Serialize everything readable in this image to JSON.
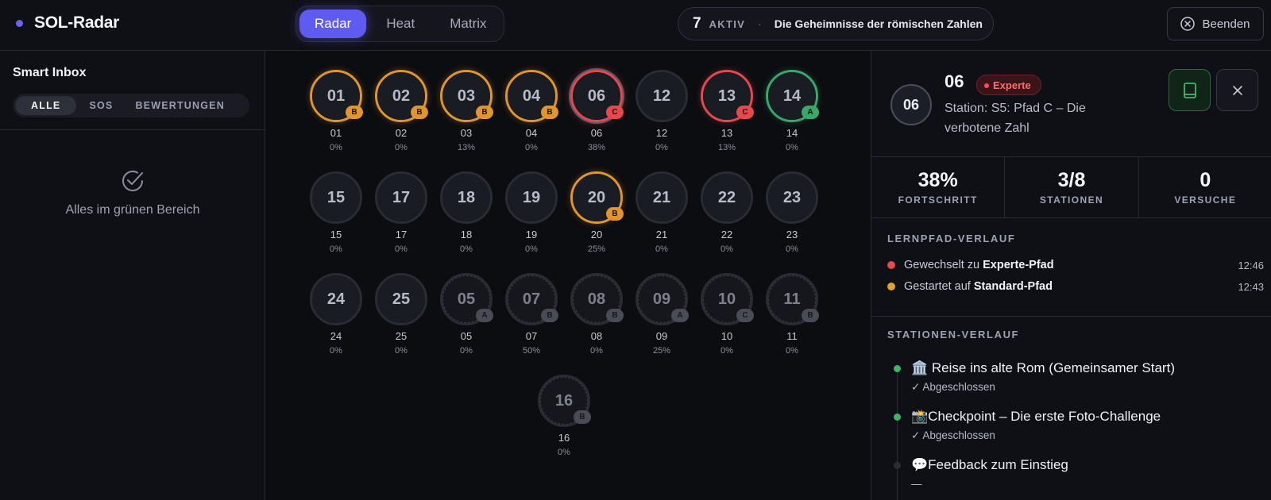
{
  "app": {
    "title": "SOL-Radar"
  },
  "tabs": [
    {
      "label": "Radar",
      "active": true
    },
    {
      "label": "Heat",
      "active": false
    },
    {
      "label": "Matrix",
      "active": false
    }
  ],
  "status": {
    "count": "7",
    "label": "AKTIV",
    "separator": "·",
    "title": "Die Geheimnisse der römischen Zahlen"
  },
  "end_button": {
    "label": "Beenden"
  },
  "inbox": {
    "title": "Smart Inbox",
    "filters": [
      {
        "label": "ALLE",
        "active": true
      },
      {
        "label": "SOS",
        "active": false
      },
      {
        "label": "BEWERTUNGEN",
        "active": false
      }
    ],
    "empty_text": "Alles im grünen Bereich"
  },
  "colors": {
    "B": "#e0952e",
    "C": "#e5484d",
    "A": "#3aa86b",
    "none": "#2c2e38"
  },
  "stations": [
    {
      "id": "01",
      "label": "01",
      "pct": "0%",
      "badge": "B",
      "ring": "B",
      "dim": false
    },
    {
      "id": "02",
      "label": "02",
      "pct": "0%",
      "badge": "B",
      "ring": "B",
      "dim": false
    },
    {
      "id": "03",
      "label": "03",
      "pct": "13%",
      "badge": "B",
      "ring": "B",
      "dim": false
    },
    {
      "id": "04",
      "label": "04",
      "pct": "0%",
      "badge": "B",
      "ring": "B",
      "dim": false
    },
    {
      "id": "06",
      "label": "06",
      "pct": "38%",
      "badge": "C",
      "ring": "C",
      "dim": false,
      "selected": true
    },
    {
      "id": "12",
      "label": "12",
      "pct": "0%",
      "badge": "",
      "ring": "none",
      "dim": false
    },
    {
      "id": "13",
      "label": "13",
      "pct": "13%",
      "badge": "C",
      "ring": "C",
      "dim": false
    },
    {
      "id": "14",
      "label": "14",
      "pct": "0%",
      "badge": "A",
      "ring": "A",
      "dim": false
    },
    {
      "id": "15",
      "label": "15",
      "pct": "0%",
      "badge": "",
      "ring": "none",
      "dim": false
    },
    {
      "id": "17",
      "label": "17",
      "pct": "0%",
      "badge": "",
      "ring": "none",
      "dim": false
    },
    {
      "id": "18",
      "label": "18",
      "pct": "0%",
      "badge": "",
      "ring": "none",
      "dim": false
    },
    {
      "id": "19",
      "label": "19",
      "pct": "0%",
      "badge": "",
      "ring": "none",
      "dim": false
    },
    {
      "id": "20",
      "label": "20",
      "pct": "25%",
      "badge": "B",
      "ring": "B",
      "dim": false
    },
    {
      "id": "21",
      "label": "21",
      "pct": "0%",
      "badge": "",
      "ring": "none",
      "dim": false
    },
    {
      "id": "22",
      "label": "22",
      "pct": "0%",
      "badge": "",
      "ring": "none",
      "dim": false
    },
    {
      "id": "23",
      "label": "23",
      "pct": "0%",
      "badge": "",
      "ring": "none",
      "dim": false
    },
    {
      "id": "24",
      "label": "24",
      "pct": "0%",
      "badge": "",
      "ring": "none",
      "dim": false
    },
    {
      "id": "25",
      "label": "25",
      "pct": "0%",
      "badge": "",
      "ring": "none",
      "dim": false
    },
    {
      "id": "05",
      "label": "05",
      "pct": "0%",
      "badge": "A",
      "ring": "none",
      "dim": true
    },
    {
      "id": "07",
      "label": "07",
      "pct": "50%",
      "badge": "B",
      "ring": "none",
      "dim": true
    },
    {
      "id": "08",
      "label": "08",
      "pct": "0%",
      "badge": "B",
      "ring": "none",
      "dim": true
    },
    {
      "id": "09",
      "label": "09",
      "pct": "25%",
      "badge": "A",
      "ring": "none",
      "dim": true
    },
    {
      "id": "10",
      "label": "10",
      "pct": "0%",
      "badge": "C",
      "ring": "none",
      "dim": true
    },
    {
      "id": "11",
      "label": "11",
      "pct": "0%",
      "badge": "B",
      "ring": "none",
      "dim": true
    },
    {
      "id": "16",
      "label": "16",
      "pct": "0%",
      "badge": "B",
      "ring": "none",
      "dim": true
    }
  ],
  "detail": {
    "id": "06",
    "level": "Experte",
    "station": "Station: S5: Pfad C – Die verbotene Zahl",
    "stats": [
      {
        "value": "38%",
        "label": "FORTSCHRITT"
      },
      {
        "value": "3/8",
        "label": "STATIONEN"
      },
      {
        "value": "0",
        "label": "VERSUCHE"
      }
    ],
    "path_title": "LERNPFAD-VERLAUF",
    "path_events": [
      {
        "prefix": "Gewechselt zu ",
        "bold": "Experte-Pfad",
        "time": "12:46",
        "color": "#e5484d"
      },
      {
        "prefix": "Gestartet auf ",
        "bold": "Standard-Pfad",
        "time": "12:43",
        "color": "#e0a12e"
      }
    ],
    "history_title": "STATIONEN-VERLAUF",
    "history": [
      {
        "title": "🏛️ Reise ins alte Rom (Gemeinsamer Start)",
        "status": "✓ Abgeschlossen",
        "color": "#3fb468"
      },
      {
        "title": "📸Checkpoint – Die erste Foto-Challenge",
        "status": "✓ Abgeschlossen",
        "color": "#3fb468"
      },
      {
        "title": "💬Feedback zum Einstieg",
        "status": "—",
        "color": "#2a2c35"
      }
    ]
  }
}
